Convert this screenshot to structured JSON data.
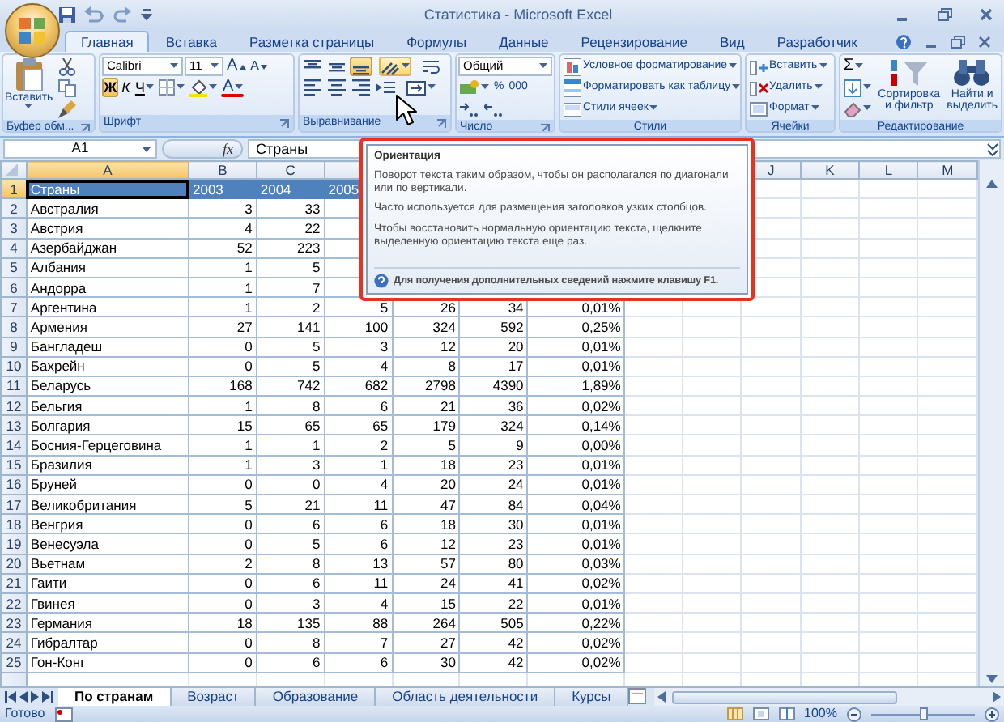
{
  "window": {
    "title": "Статистика - Microsoft Excel"
  },
  "tabs": [
    {
      "label": "Главная",
      "selected": true
    },
    {
      "label": "Вставка",
      "selected": false
    },
    {
      "label": "Разметка страницы",
      "selected": false
    },
    {
      "label": "Формулы",
      "selected": false
    },
    {
      "label": "Данные",
      "selected": false
    },
    {
      "label": "Рецензирование",
      "selected": false
    },
    {
      "label": "Вид",
      "selected": false
    },
    {
      "label": "Разработчик",
      "selected": false
    }
  ],
  "ribbon_groups": [
    {
      "kind": "clipboard",
      "label": "Буфер обм...",
      "paste": "Вставить"
    },
    {
      "kind": "font",
      "label": "Шрифт",
      "font_name": "Calibri",
      "font_size": "11",
      "grow": "A",
      "shrink": "A",
      "styles": [
        {
          "kind": "bold",
          "label": "Ж",
          "selected": true
        },
        {
          "kind": "italic",
          "label": "К",
          "selected": false
        },
        {
          "kind": "underline",
          "label": "Ч",
          "selected": false
        }
      ],
      "font_color": "A"
    },
    {
      "kind": "alignment",
      "label": "Выравнивание",
      "vertical": [
        {
          "kind": "top",
          "selected": false
        },
        {
          "kind": "middle",
          "selected": false
        },
        {
          "kind": "bottom",
          "selected": true
        }
      ],
      "orientation": {
        "hovered": true
      }
    },
    {
      "kind": "number",
      "label": "Число",
      "format": "Общий",
      "percent": "%",
      "thousands": "000"
    },
    {
      "kind": "styles",
      "label": "Стили",
      "items": [
        "Условное форматирование",
        "Форматировать как таблицу",
        "Стили ячеек"
      ]
    },
    {
      "kind": "cells",
      "label": "Ячейки",
      "items": [
        "Вставить",
        "Удалить",
        "Формат"
      ]
    },
    {
      "kind": "editing",
      "label": "Редактирование",
      "sum": "Σ",
      "sort": "Сортировка и фильтр",
      "find": "Найти и выделить"
    }
  ],
  "formula_bar": {
    "name_box": "A1",
    "function_button": "fx",
    "content": "Страны"
  },
  "column_headers": [
    {
      "label": "A",
      "selected": true
    },
    {
      "label": "B",
      "selected": false
    },
    {
      "label": "C",
      "selected": false
    },
    {
      "label": "J",
      "selected": false
    },
    {
      "label": "K",
      "selected": false
    },
    {
      "label": "L",
      "selected": false
    },
    {
      "label": "M",
      "selected": false
    }
  ],
  "rows": [
    {
      "num": "1",
      "selected": true,
      "kind": "header",
      "country": "Страны",
      "values": [
        "2003",
        "2004",
        "2005"
      ]
    },
    {
      "num": "2",
      "selected": false,
      "country": "Австралия",
      "values": [
        "3",
        "33"
      ]
    },
    {
      "num": "3",
      "selected": false,
      "country": "Австрия",
      "values": [
        "4",
        "22"
      ]
    },
    {
      "num": "4",
      "selected": false,
      "country": "Азербайджан",
      "values": [
        "52",
        "223"
      ]
    },
    {
      "num": "5",
      "selected": false,
      "country": "Албания",
      "values": [
        "1",
        "5"
      ]
    },
    {
      "num": "6",
      "selected": false,
      "country": "Андорра",
      "values": [
        "1",
        "7"
      ]
    },
    {
      "num": "7",
      "selected": false,
      "country": "Аргентина",
      "values": [
        "1",
        "2",
        "5",
        "26",
        "34",
        "0,01%"
      ]
    },
    {
      "num": "8",
      "selected": false,
      "country": "Армения",
      "values": [
        "27",
        "141",
        "100",
        "324",
        "592",
        "0,25%"
      ]
    },
    {
      "num": "9",
      "selected": false,
      "country": "Бангладеш",
      "values": [
        "0",
        "5",
        "3",
        "12",
        "20",
        "0,01%"
      ]
    },
    {
      "num": "10",
      "selected": false,
      "country": "Бахрейн",
      "values": [
        "0",
        "5",
        "4",
        "8",
        "17",
        "0,01%"
      ]
    },
    {
      "num": "11",
      "selected": false,
      "country": "Беларусь",
      "values": [
        "168",
        "742",
        "682",
        "2798",
        "4390",
        "1,89%"
      ]
    },
    {
      "num": "12",
      "selected": false,
      "country": "Бельгия",
      "values": [
        "1",
        "8",
        "6",
        "21",
        "36",
        "0,02%"
      ]
    },
    {
      "num": "13",
      "selected": false,
      "country": "Болгария",
      "values": [
        "15",
        "65",
        "65",
        "179",
        "324",
        "0,14%"
      ]
    },
    {
      "num": "14",
      "selected": false,
      "country": "Босния-Герцеговина",
      "values": [
        "1",
        "1",
        "2",
        "5",
        "9",
        "0,00%"
      ]
    },
    {
      "num": "15",
      "selected": false,
      "country": "Бразилия",
      "values": [
        "1",
        "3",
        "1",
        "18",
        "23",
        "0,01%"
      ]
    },
    {
      "num": "16",
      "selected": false,
      "country": "Бруней",
      "values": [
        "0",
        "0",
        "4",
        "20",
        "24",
        "0,01%"
      ]
    },
    {
      "num": "17",
      "selected": false,
      "country": "Великобритания",
      "values": [
        "5",
        "21",
        "11",
        "47",
        "84",
        "0,04%"
      ]
    },
    {
      "num": "18",
      "selected": false,
      "country": "Венгрия",
      "values": [
        "0",
        "6",
        "6",
        "18",
        "30",
        "0,01%"
      ]
    },
    {
      "num": "19",
      "selected": false,
      "country": "Венесуэла",
      "values": [
        "0",
        "5",
        "6",
        "12",
        "23",
        "0,01%"
      ]
    },
    {
      "num": "20",
      "selected": false,
      "country": "Вьетнам",
      "values": [
        "2",
        "8",
        "13",
        "57",
        "80",
        "0,03%"
      ]
    },
    {
      "num": "21",
      "selected": false,
      "country": "Гаити",
      "values": [
        "0",
        "6",
        "11",
        "24",
        "41",
        "0,02%"
      ]
    },
    {
      "num": "22",
      "selected": false,
      "country": "Гвинея",
      "values": [
        "0",
        "3",
        "4",
        "15",
        "22",
        "0,01%"
      ]
    },
    {
      "num": "23",
      "selected": false,
      "country": "Германия",
      "values": [
        "18",
        "135",
        "88",
        "264",
        "505",
        "0,22%"
      ]
    },
    {
      "num": "24",
      "selected": false,
      "country": "Гибралтар",
      "values": [
        "0",
        "8",
        "7",
        "27",
        "42",
        "0,02%"
      ]
    },
    {
      "num": "25",
      "selected": false,
      "country": "Гон-Конг",
      "values": [
        "0",
        "6",
        "6",
        "30",
        "42",
        "0,02%"
      ]
    }
  ],
  "tooltip": {
    "title": "Ориентация",
    "paragraphs": [
      "Поворот текста таким образом, чтобы он располагался по диагонали или по вертикали.",
      "Часто используется для размещения заголовков узких столбцов.",
      "Чтобы восстановить нормальную ориентацию текста, щелкните выделенную ориентацию текста еще раз."
    ],
    "help": "Для получения дополнительных сведений нажмите клавишу F1."
  },
  "sheet_tabs": [
    {
      "label": "По странам",
      "selected": true
    },
    {
      "label": "Возраст",
      "selected": false
    },
    {
      "label": "Образование",
      "selected": false
    },
    {
      "label": "Область деятельности",
      "selected": false
    },
    {
      "label": "Курсы",
      "selected": false
    }
  ],
  "status_bar": {
    "text": "Готово",
    "zoom": "100%",
    "zoom_slider": {
      "level": 0.5
    }
  }
}
